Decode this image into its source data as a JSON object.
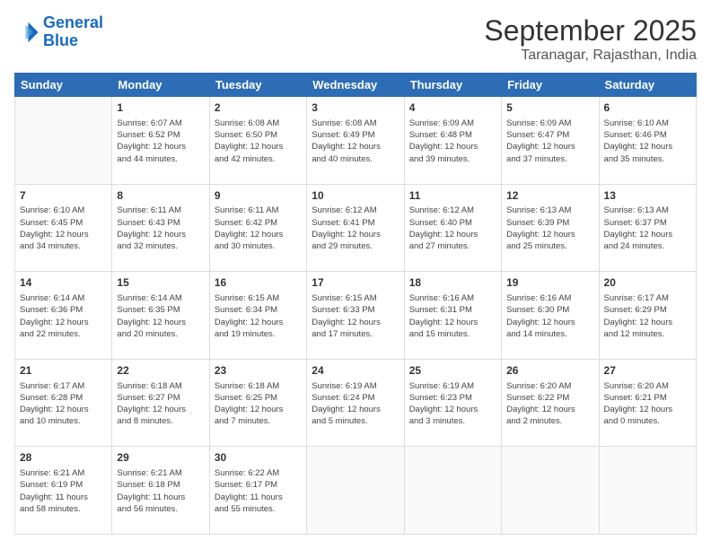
{
  "logo": {
    "line1": "General",
    "line2": "Blue"
  },
  "title": "September 2025",
  "location": "Taranagar, Rajasthan, India",
  "days_of_week": [
    "Sunday",
    "Monday",
    "Tuesday",
    "Wednesday",
    "Thursday",
    "Friday",
    "Saturday"
  ],
  "weeks": [
    [
      {
        "day": "",
        "info": ""
      },
      {
        "day": "1",
        "info": "Sunrise: 6:07 AM\nSunset: 6:52 PM\nDaylight: 12 hours\nand 44 minutes."
      },
      {
        "day": "2",
        "info": "Sunrise: 6:08 AM\nSunset: 6:50 PM\nDaylight: 12 hours\nand 42 minutes."
      },
      {
        "day": "3",
        "info": "Sunrise: 6:08 AM\nSunset: 6:49 PM\nDaylight: 12 hours\nand 40 minutes."
      },
      {
        "day": "4",
        "info": "Sunrise: 6:09 AM\nSunset: 6:48 PM\nDaylight: 12 hours\nand 39 minutes."
      },
      {
        "day": "5",
        "info": "Sunrise: 6:09 AM\nSunset: 6:47 PM\nDaylight: 12 hours\nand 37 minutes."
      },
      {
        "day": "6",
        "info": "Sunrise: 6:10 AM\nSunset: 6:46 PM\nDaylight: 12 hours\nand 35 minutes."
      }
    ],
    [
      {
        "day": "7",
        "info": "Sunrise: 6:10 AM\nSunset: 6:45 PM\nDaylight: 12 hours\nand 34 minutes."
      },
      {
        "day": "8",
        "info": "Sunrise: 6:11 AM\nSunset: 6:43 PM\nDaylight: 12 hours\nand 32 minutes."
      },
      {
        "day": "9",
        "info": "Sunrise: 6:11 AM\nSunset: 6:42 PM\nDaylight: 12 hours\nand 30 minutes."
      },
      {
        "day": "10",
        "info": "Sunrise: 6:12 AM\nSunset: 6:41 PM\nDaylight: 12 hours\nand 29 minutes."
      },
      {
        "day": "11",
        "info": "Sunrise: 6:12 AM\nSunset: 6:40 PM\nDaylight: 12 hours\nand 27 minutes."
      },
      {
        "day": "12",
        "info": "Sunrise: 6:13 AM\nSunset: 6:39 PM\nDaylight: 12 hours\nand 25 minutes."
      },
      {
        "day": "13",
        "info": "Sunrise: 6:13 AM\nSunset: 6:37 PM\nDaylight: 12 hours\nand 24 minutes."
      }
    ],
    [
      {
        "day": "14",
        "info": "Sunrise: 6:14 AM\nSunset: 6:36 PM\nDaylight: 12 hours\nand 22 minutes."
      },
      {
        "day": "15",
        "info": "Sunrise: 6:14 AM\nSunset: 6:35 PM\nDaylight: 12 hours\nand 20 minutes."
      },
      {
        "day": "16",
        "info": "Sunrise: 6:15 AM\nSunset: 6:34 PM\nDaylight: 12 hours\nand 19 minutes."
      },
      {
        "day": "17",
        "info": "Sunrise: 6:15 AM\nSunset: 6:33 PM\nDaylight: 12 hours\nand 17 minutes."
      },
      {
        "day": "18",
        "info": "Sunrise: 6:16 AM\nSunset: 6:31 PM\nDaylight: 12 hours\nand 15 minutes."
      },
      {
        "day": "19",
        "info": "Sunrise: 6:16 AM\nSunset: 6:30 PM\nDaylight: 12 hours\nand 14 minutes."
      },
      {
        "day": "20",
        "info": "Sunrise: 6:17 AM\nSunset: 6:29 PM\nDaylight: 12 hours\nand 12 minutes."
      }
    ],
    [
      {
        "day": "21",
        "info": "Sunrise: 6:17 AM\nSunset: 6:28 PM\nDaylight: 12 hours\nand 10 minutes."
      },
      {
        "day": "22",
        "info": "Sunrise: 6:18 AM\nSunset: 6:27 PM\nDaylight: 12 hours\nand 8 minutes."
      },
      {
        "day": "23",
        "info": "Sunrise: 6:18 AM\nSunset: 6:25 PM\nDaylight: 12 hours\nand 7 minutes."
      },
      {
        "day": "24",
        "info": "Sunrise: 6:19 AM\nSunset: 6:24 PM\nDaylight: 12 hours\nand 5 minutes."
      },
      {
        "day": "25",
        "info": "Sunrise: 6:19 AM\nSunset: 6:23 PM\nDaylight: 12 hours\nand 3 minutes."
      },
      {
        "day": "26",
        "info": "Sunrise: 6:20 AM\nSunset: 6:22 PM\nDaylight: 12 hours\nand 2 minutes."
      },
      {
        "day": "27",
        "info": "Sunrise: 6:20 AM\nSunset: 6:21 PM\nDaylight: 12 hours\nand 0 minutes."
      }
    ],
    [
      {
        "day": "28",
        "info": "Sunrise: 6:21 AM\nSunset: 6:19 PM\nDaylight: 11 hours\nand 58 minutes."
      },
      {
        "day": "29",
        "info": "Sunrise: 6:21 AM\nSunset: 6:18 PM\nDaylight: 11 hours\nand 56 minutes."
      },
      {
        "day": "30",
        "info": "Sunrise: 6:22 AM\nSunset: 6:17 PM\nDaylight: 11 hours\nand 55 minutes."
      },
      {
        "day": "",
        "info": ""
      },
      {
        "day": "",
        "info": ""
      },
      {
        "day": "",
        "info": ""
      },
      {
        "day": "",
        "info": ""
      }
    ]
  ]
}
